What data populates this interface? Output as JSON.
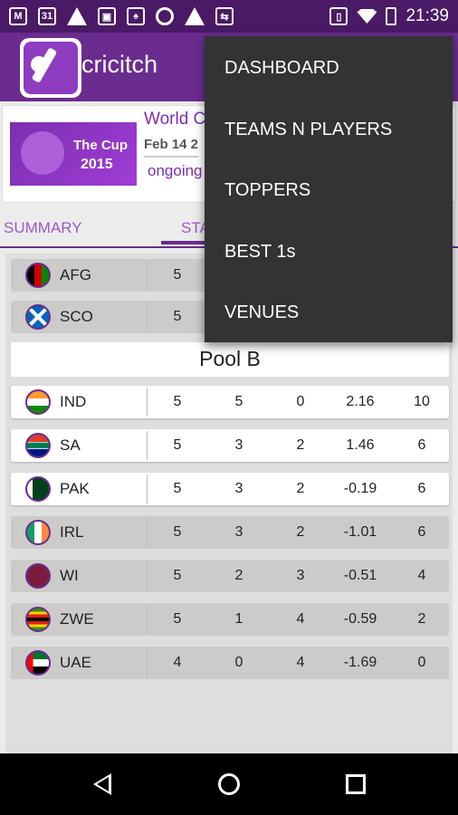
{
  "status_bar": {
    "time": "21:39",
    "icons": [
      "gmail-icon",
      "calendar-icon",
      "warning-icon",
      "photo-icon",
      "cricket-icon",
      "chrome-icon",
      "warning-icon",
      "usb-icon",
      "vibrate-icon",
      "wifi-icon",
      "battery-icon"
    ],
    "calendar_day": "31"
  },
  "appbar": {
    "title": "cricitch"
  },
  "info_card": {
    "title": "World C",
    "date": "Feb 14 2",
    "status": "ongoing",
    "banner_line1": "The Cup",
    "banner_line2": "2015"
  },
  "tabs": {
    "summary": "SUMMARY",
    "standings": "STA",
    "right": "S"
  },
  "pool_b": {
    "label": "Pool B"
  },
  "pool_a_rows": [
    {
      "team": "AFG",
      "flag": "afghanistan-flag",
      "values": [
        "5",
        "",
        "",
        "",
        ""
      ]
    },
    {
      "team": "SCO",
      "flag": "scotland-flag",
      "values": [
        "5",
        "",
        "",
        "",
        ""
      ]
    }
  ],
  "pool_b_rows": [
    {
      "team": "IND",
      "flag": "india-flag",
      "values": [
        "5",
        "5",
        "0",
        "2.16",
        "10"
      ]
    },
    {
      "team": "SA",
      "flag": "south-africa-flag",
      "values": [
        "5",
        "3",
        "2",
        "1.46",
        "6"
      ]
    },
    {
      "team": "PAK",
      "flag": "pakistan-flag",
      "values": [
        "5",
        "3",
        "2",
        "-0.19",
        "6"
      ]
    },
    {
      "team": "IRL",
      "flag": "ireland-flag",
      "values": [
        "5",
        "3",
        "2",
        "-1.01",
        "6"
      ]
    },
    {
      "team": "WI",
      "flag": "west-indies-flag",
      "values": [
        "5",
        "2",
        "3",
        "-0.51",
        "4"
      ]
    },
    {
      "team": "ZWE",
      "flag": "zimbabwe-flag",
      "values": [
        "5",
        "1",
        "4",
        "-0.59",
        "2"
      ]
    },
    {
      "team": "UAE",
      "flag": "uae-flag",
      "values": [
        "4",
        "0",
        "4",
        "-1.69",
        "0"
      ]
    }
  ],
  "menu": {
    "items": [
      "DASHBOARD",
      "TEAMS N PLAYERS",
      "TOPPERS",
      "BEST 1s",
      "VENUES"
    ]
  },
  "colors": {
    "primary": "#6a2c8e",
    "status_bar": "#4a1a66",
    "menu_bg": "#333333"
  }
}
